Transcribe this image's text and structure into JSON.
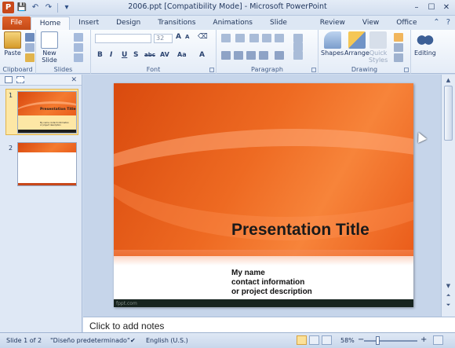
{
  "window": {
    "title": "2006.ppt [Compatibility Mode] - Microsoft PowerPoint",
    "app_icon_letter": "P",
    "controls": {
      "minimize": "–",
      "maximize": "☐",
      "close": "✕"
    }
  },
  "quick_access": {
    "save": "💾",
    "undo": "↶",
    "redo": "↷",
    "customize": "▾"
  },
  "tabs": {
    "file": "File",
    "items": [
      "Home",
      "Insert",
      "Design",
      "Transitions",
      "Animations",
      "Slide Show",
      "Review",
      "View",
      "Office Timeline+"
    ],
    "active": "Home"
  },
  "ribbon": {
    "clipboard": {
      "label": "Clipboard",
      "paste": "Paste"
    },
    "slides": {
      "label": "Slides",
      "new_slide_line1": "New",
      "new_slide_line2": "Slide"
    },
    "font": {
      "label": "Font",
      "font_name": "",
      "font_size": "32",
      "bold": "B",
      "italic": "I",
      "underline": "U",
      "strike": "S",
      "abc": "abc",
      "av": "AV",
      "aa": "Aa",
      "a_color": "A"
    },
    "paragraph": {
      "label": "Paragraph"
    },
    "drawing": {
      "label": "Drawing",
      "shapes": "Shapes",
      "arrange": "Arrange",
      "quick_styles_line1": "Quick",
      "quick_styles_line2": "Styles"
    },
    "editing": {
      "label": "Editing"
    }
  },
  "slides_panel": {
    "thumbnails": [
      {
        "number": "1",
        "title": "Presentation Title",
        "sub": "My name contact information or project description"
      },
      {
        "number": "2"
      }
    ]
  },
  "slide": {
    "title": "Presentation Title",
    "subtitle_lines": [
      "My name",
      "contact information",
      "or project description"
    ],
    "footer": "fppt.com"
  },
  "notes": {
    "placeholder": "Click to add notes"
  },
  "status": {
    "slide_info": "Slide 1 of 2",
    "theme": "\"Diseño predeterminado\"",
    "language": "English (U.S.)",
    "zoom": "58%",
    "zoom_fraction": 0.58
  },
  "colors": {
    "accent": "#d9480f",
    "file_tab": "#c54a16",
    "ribbon_bg": "#e4ecf7"
  }
}
